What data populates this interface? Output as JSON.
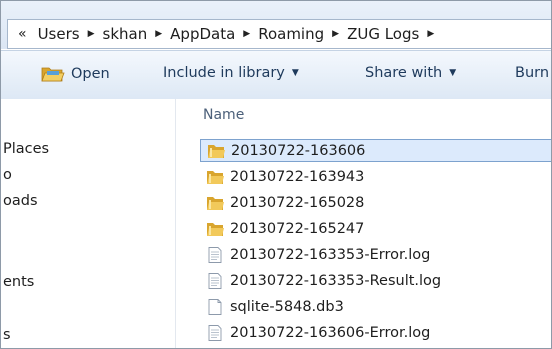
{
  "address_bar": {
    "back_glyph": "«",
    "breadcrumbs": [
      "Users",
      "skhan",
      "AppData",
      "Roaming",
      "ZUG Logs"
    ],
    "separator": "▶"
  },
  "toolbar": {
    "open_label": "Open",
    "include_label": "Include in library",
    "share_label": "Share with",
    "burn_label": "Burn",
    "dropdown_glyph": "▼"
  },
  "nav_pane": {
    "items": [
      "Places",
      "o",
      "oads",
      "ents",
      "s"
    ]
  },
  "file_list": {
    "column_name": "Name",
    "files": [
      {
        "name": "20130722-163606",
        "type": "folder",
        "selected": true
      },
      {
        "name": "20130722-163943",
        "type": "folder",
        "selected": false
      },
      {
        "name": "20130722-165028",
        "type": "folder",
        "selected": false
      },
      {
        "name": "20130722-165247",
        "type": "folder",
        "selected": false
      },
      {
        "name": "20130722-163353-Error.log",
        "type": "text-file",
        "selected": false
      },
      {
        "name": "20130722-163353-Result.log",
        "type": "text-file",
        "selected": false
      },
      {
        "name": "sqlite-5848.db3",
        "type": "blank-file",
        "selected": false
      },
      {
        "name": "20130722-163606-Error.log",
        "type": "text-file",
        "selected": false
      }
    ]
  },
  "colors": {
    "selection_fill": "#dceafc",
    "selection_border": "#7da2ce",
    "folder": "#e8b93c"
  }
}
